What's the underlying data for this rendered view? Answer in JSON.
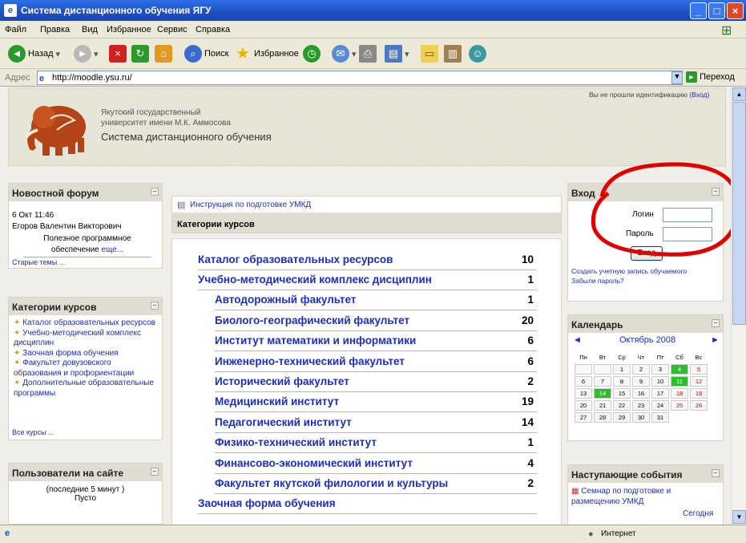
{
  "window": {
    "title": "Система дистанционного обучения ЯГУ"
  },
  "menu": [
    "Файл",
    "Правка",
    "Вид",
    "Избранное",
    "Сервис",
    "Справка"
  ],
  "toolbar": {
    "back": "Назад",
    "search": "Поиск",
    "favorites": "Избранное"
  },
  "address": {
    "label": "Адрес",
    "url": "http://moodle.ysu.ru/",
    "go": "Переход"
  },
  "header": {
    "univ_line1": "Якутский государственный",
    "univ_line2": "университет имени М.К. Аммосова",
    "system": "Система дистанционного обучения",
    "login_status": "Вы не прошли идентификацию",
    "login_link": "(Вход)"
  },
  "news": {
    "title": "Новостной форум",
    "date": "6 Окт 11:46",
    "author": "Егоров Валентин Викторович",
    "subject": "Полезное программное обеспечение",
    "more": "еще...",
    "old": "Старые темы ..."
  },
  "leftcats": {
    "title": "Категории курсов",
    "items": [
      "Каталог образовательных ресурсов",
      "Учебно-методический комплекс дисциплин",
      "Заочная форма обучения",
      "Факультет довузовского образования и профориентации",
      "Дополнительные образовательные программы"
    ],
    "all": "Все курсы ..."
  },
  "users": {
    "title": "Пользователи на сайте",
    "period": "(последние 5 минут )",
    "empty": "Пусто"
  },
  "center": {
    "instruction": "Инструкция по подготовке УМКД",
    "cats_title": "Категории курсов"
  },
  "categories": [
    {
      "name": "Каталог образовательных ресурсов",
      "count": "10"
    },
    {
      "name": "Учебно-методический комплекс дисциплин",
      "count": "1"
    },
    {
      "name": "Автодорожный факультет",
      "count": "1"
    },
    {
      "name": "Биолого-географический факультет",
      "count": "20"
    },
    {
      "name": "Институт математики и информатики",
      "count": "6"
    },
    {
      "name": "Инженерно-технический факультет",
      "count": "6"
    },
    {
      "name": "Исторический факультет",
      "count": "2"
    },
    {
      "name": "Медицинский институт",
      "count": "19"
    },
    {
      "name": "Педагогический институт",
      "count": "14"
    },
    {
      "name": "Физико-технический институт",
      "count": "1"
    },
    {
      "name": "Финансово-экономический институт",
      "count": "4"
    },
    {
      "name": "Факультет якутской филологии и культуры",
      "count": "2"
    },
    {
      "name": "Заочная форма обучения",
      "count": ""
    }
  ],
  "login": {
    "title": "Вход",
    "login_label": "Логин",
    "password_label": "Пароль",
    "button": "Вход",
    "create": "Создать учетную запись обучаемого",
    "forgot": "Забыли пароль?"
  },
  "calendar": {
    "title": "Календарь",
    "month": "Октябрь 2008",
    "prev": "◄",
    "next": "►",
    "days": [
      "Пн",
      "Вт",
      "Ср",
      "Чт",
      "Пт",
      "Сб",
      "Вс"
    ],
    "weeks": [
      [
        "",
        "",
        "1",
        "2",
        "3",
        "4",
        "5"
      ],
      [
        "6",
        "7",
        "8",
        "9",
        "10",
        "11",
        "12"
      ],
      [
        "13",
        "14",
        "15",
        "16",
        "17",
        "18",
        "19"
      ],
      [
        "20",
        "21",
        "22",
        "23",
        "24",
        "25",
        "26"
      ],
      [
        "27",
        "28",
        "29",
        "30",
        "31",
        "",
        ""
      ]
    ]
  },
  "events": {
    "title": "Наступающие события",
    "item": "Семнар по подготовке и размещению УМКД",
    "today": "Сегодня"
  },
  "status": {
    "zone": "Интернет"
  },
  "colors": {
    "titlebar": "#1d4fc4",
    "link": "#1a2ccc",
    "highlight_red": "#e00000",
    "today_green": "#22aa22"
  }
}
